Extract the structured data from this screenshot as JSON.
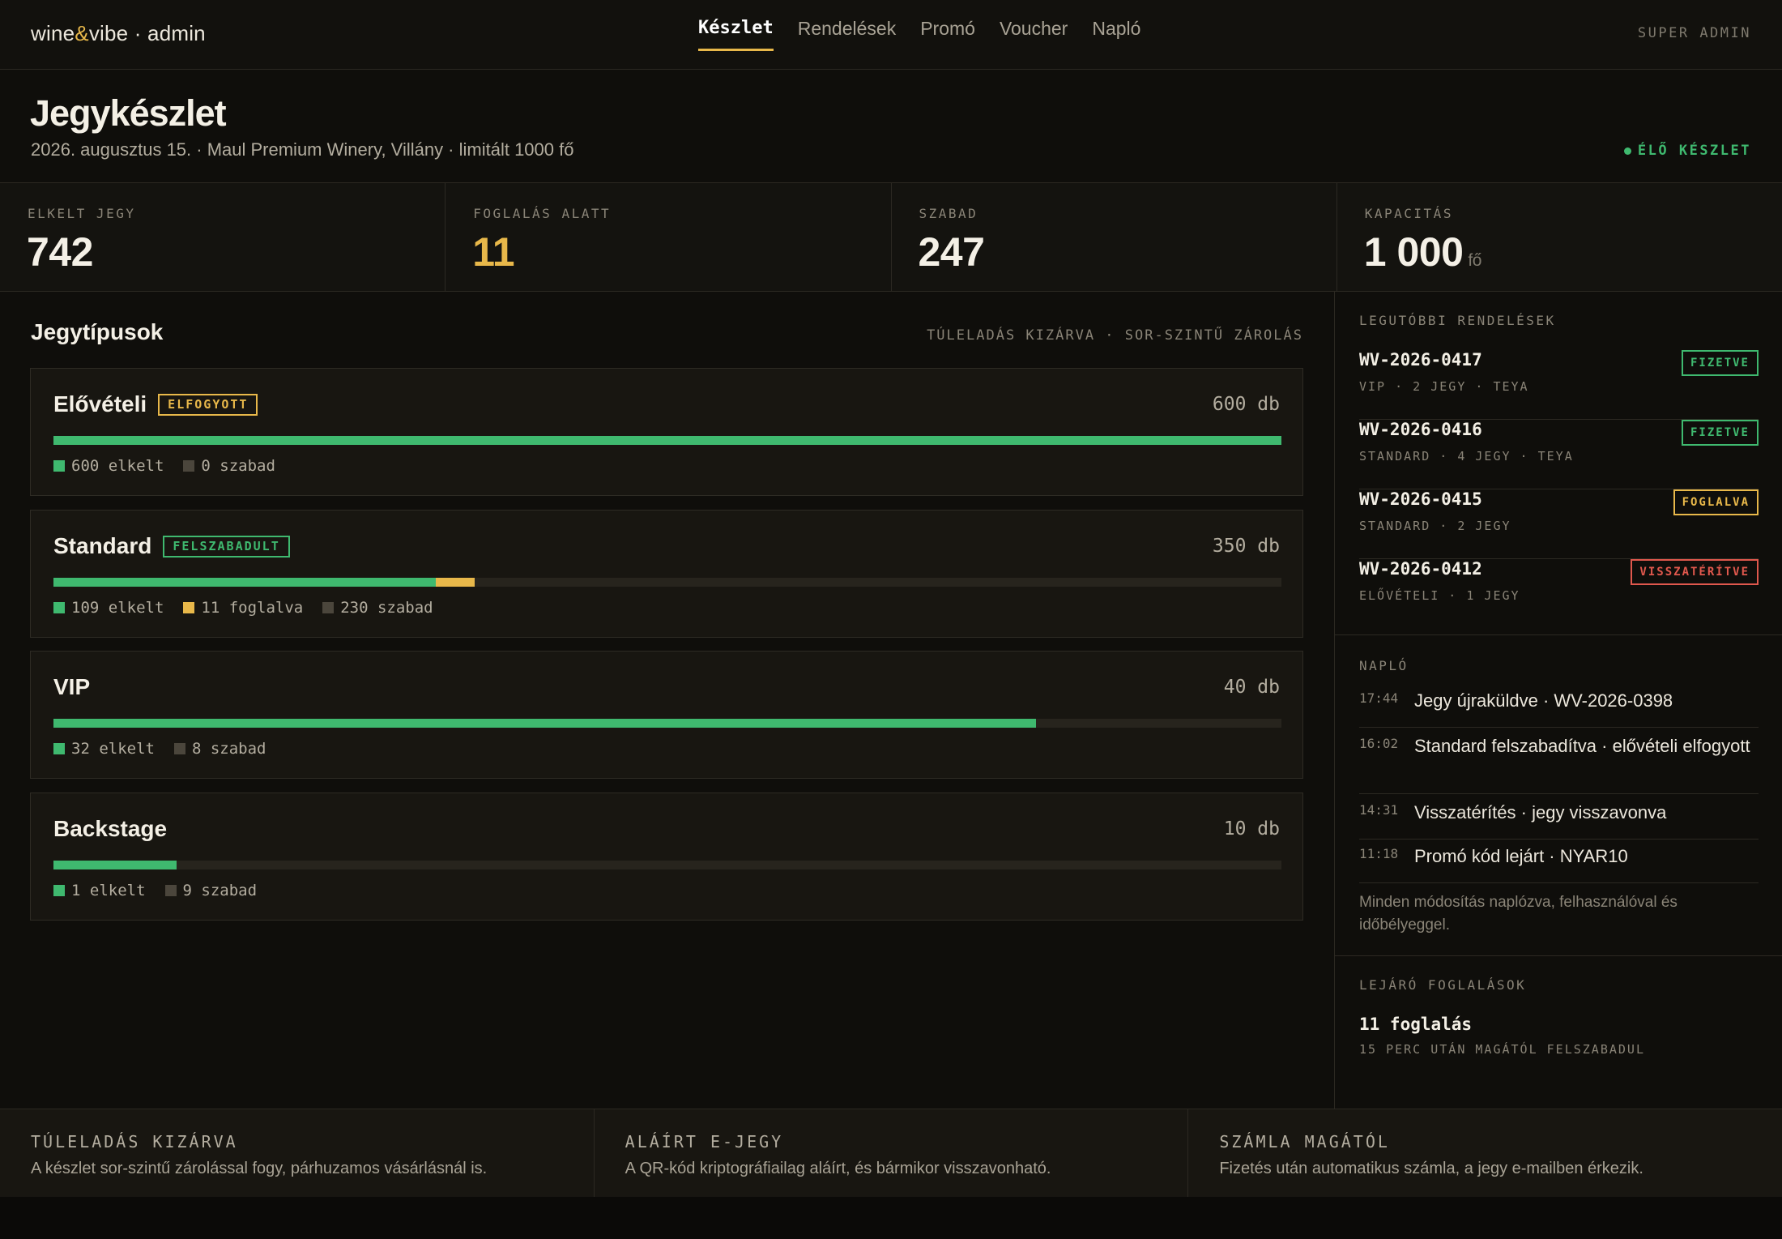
{
  "app": {
    "brand_pre": "wine",
    "brand_amp": "&",
    "brand_post": "vibe · admin",
    "role": "SUPER ADMIN"
  },
  "nav": [
    {
      "label": "Készlet",
      "active": true
    },
    {
      "label": "Rendelések"
    },
    {
      "label": "Promó"
    },
    {
      "label": "Voucher"
    },
    {
      "label": "Napló"
    }
  ],
  "header": {
    "title": "Jegykészlet",
    "subtitle": "2026. augusztus 15. · Maul Premium Winery, Villány · limitált 1000 fő",
    "live": "ÉLŐ KÉSZLET"
  },
  "kpis": [
    {
      "label": "ELKELT JEGY",
      "value": "742"
    },
    {
      "label": "FOGLALÁS ALATT",
      "value": "11"
    },
    {
      "label": "SZABAD",
      "value": "247"
    },
    {
      "label": "KAPACITÁS",
      "value": "1 000",
      "unit": "fő"
    }
  ],
  "ticket_types": {
    "title": "Jegytípusok",
    "note": "TÚLELADÁS KIZÁRVA · SOR-SZINTŰ ZÁROLÁS",
    "items": [
      {
        "name": "Elővételi",
        "badge": "ELFOGYOTT",
        "qty": "600 db",
        "sold_frac": 1.0,
        "held_frac": 0.0,
        "legend": [
          "600 elkelt",
          "0 szabad"
        ]
      },
      {
        "name": "Standard",
        "badge": "FELSZABADULT",
        "qty": "350 db",
        "sold_frac": 0.3114,
        "held_frac": 0.0314,
        "legend": [
          "109 elkelt",
          "11 foglalva",
          "230 szabad"
        ]
      },
      {
        "name": "VIP",
        "qty": "40 db",
        "sold_frac": 0.8,
        "held_frac": 0.0,
        "legend": [
          "32 elkelt",
          "8 szabad"
        ]
      },
      {
        "name": "Backstage",
        "qty": "10 db",
        "sold_frac": 0.1,
        "held_frac": 0.0,
        "legend": [
          "1 elkelt",
          "9 szabad"
        ]
      }
    ]
  },
  "orders": {
    "label": "LEGUTÓBBI RENDELÉSEK",
    "items": [
      {
        "id": "WV-2026-0417",
        "meta": "VIP · 2 JEGY · TEYA",
        "status": "FIZETVE",
        "color": "#3fb96f"
      },
      {
        "id": "WV-2026-0416",
        "meta": "STANDARD · 4 JEGY · TEYA",
        "status": "FIZETVE",
        "color": "#3fb96f"
      },
      {
        "id": "WV-2026-0415",
        "meta": "STANDARD · 2 JEGY",
        "status": "FOGLALVA",
        "color": "#e8b84a"
      },
      {
        "id": "WV-2026-0412",
        "meta": "ELŐVÉTELI · 1 JEGY",
        "status": "VISSZATÉRÍTVE",
        "color": "#e0584d"
      }
    ]
  },
  "log": {
    "label": "NAPLÓ",
    "items": [
      {
        "time": "17:44",
        "text": "Jegy újraküldve · WV-2026-0398"
      },
      {
        "time": "16:02",
        "text": "Standard felszabadítva · elővételi elfogyott"
      },
      {
        "time": "14:31",
        "text": "Visszatérítés · jegy visszavonva"
      },
      {
        "time": "11:18",
        "text": "Promó kód lejárt · NYAR10"
      }
    ],
    "footnote": "Minden módosítás naplózva, felhasználóval és időbélyeggel."
  },
  "pending": {
    "label": "LEJÁRÓ FOGLALÁSOK",
    "title": "11 foglalás",
    "sub": "15 PERC UTÁN MAGÁTÓL FELSZABADUL"
  },
  "footer": [
    {
      "title": "TÚLELADÁS KIZÁRVA",
      "text": "A készlet sor-szintű zárolással fogy, párhuzamos vásárlásnál is."
    },
    {
      "title": "ALÁÍRT E-JEGY",
      "text": "A QR-kód kriptográfiailag aláírt, és bármikor visszavonható."
    },
    {
      "title": "SZÁMLA MAGÁTÓL",
      "text": "Fizetés után automatikus számla, a jegy e-mailben érkezik."
    }
  ],
  "colors": {
    "accent": "#e8b84a",
    "success": "#3fb96f",
    "danger": "#e0584d",
    "bg": "#0f0e0b"
  }
}
